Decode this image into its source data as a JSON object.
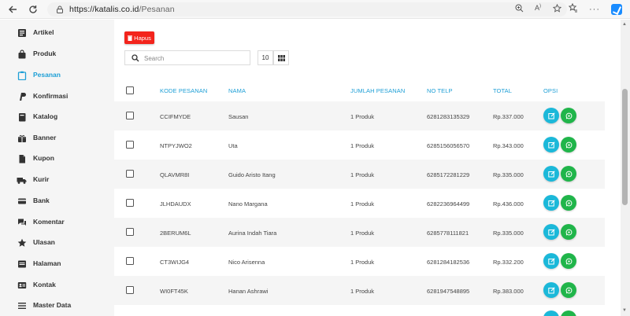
{
  "browser": {
    "url_host": "https://katalis.co.id",
    "url_path": "/Pesanan"
  },
  "sidebar": {
    "items": [
      {
        "label": "Artikel",
        "icon": "articles-icon"
      },
      {
        "label": "Produk",
        "icon": "bag-icon"
      },
      {
        "label": "Pesanan",
        "icon": "clipboard-icon",
        "active": true
      },
      {
        "label": "Konfirmasi",
        "icon": "paypal-icon"
      },
      {
        "label": "Katalog",
        "icon": "book-icon"
      },
      {
        "label": "Banner",
        "icon": "gift-icon"
      },
      {
        "label": "Kupon",
        "icon": "file-icon"
      },
      {
        "label": "Kurir",
        "icon": "truck-icon"
      },
      {
        "label": "Bank",
        "icon": "card-icon"
      },
      {
        "label": "Komentar",
        "icon": "comments-icon"
      },
      {
        "label": "Ulasan",
        "icon": "star-icon"
      },
      {
        "label": "Halaman",
        "icon": "page-icon"
      },
      {
        "label": "Kontak",
        "icon": "contact-icon"
      },
      {
        "label": "Master Data",
        "icon": "menu-icon"
      }
    ]
  },
  "toolbar": {
    "delete_label": "Hapus",
    "search_placeholder": "Search",
    "per_page": "10"
  },
  "table": {
    "headers": {
      "code": "KODE PESANAN",
      "name": "NAMA",
      "qty": "JUMLAH PESANAN",
      "phone": "NO TELP",
      "total": "TOTAL",
      "options": "OPSI"
    },
    "rows": [
      {
        "code": "CCIFMYDE",
        "name": "Sausan",
        "qty": "1 Produk",
        "phone": "6281283135329",
        "total": "Rp.337.000"
      },
      {
        "code": "NTPYJWO2",
        "name": "Uta",
        "qty": "1 Produk",
        "phone": "6285156056570",
        "total": "Rp.343.000"
      },
      {
        "code": "QLAVMR8I",
        "name": "Guido Aristo Itang",
        "qty": "1 Produk",
        "phone": "6285172281229",
        "total": "Rp.335.000"
      },
      {
        "code": "JLHDAUDX",
        "name": "Nano Margana",
        "qty": "1 Produk",
        "phone": "6282236964499",
        "total": "Rp.436.000"
      },
      {
        "code": "2BERUM6L",
        "name": "Aurina Indah Tiara",
        "qty": "1 Produk",
        "phone": "6285778111821",
        "total": "Rp.335.000"
      },
      {
        "code": "CT3WIJG4",
        "name": "Nico Arisenna",
        "qty": "1 Produk",
        "phone": "6281284182536",
        "total": "Rp.332.200"
      },
      {
        "code": "WI0FT45K",
        "name": "Hanan Ashrawi",
        "qty": "1 Produk",
        "phone": "6281947548895",
        "total": "Rp.383.000"
      }
    ]
  },
  "colors": {
    "accent": "#1e9fd6",
    "danger": "#f3241c",
    "edit": "#1bb8d9",
    "whatsapp": "#20b54a"
  }
}
